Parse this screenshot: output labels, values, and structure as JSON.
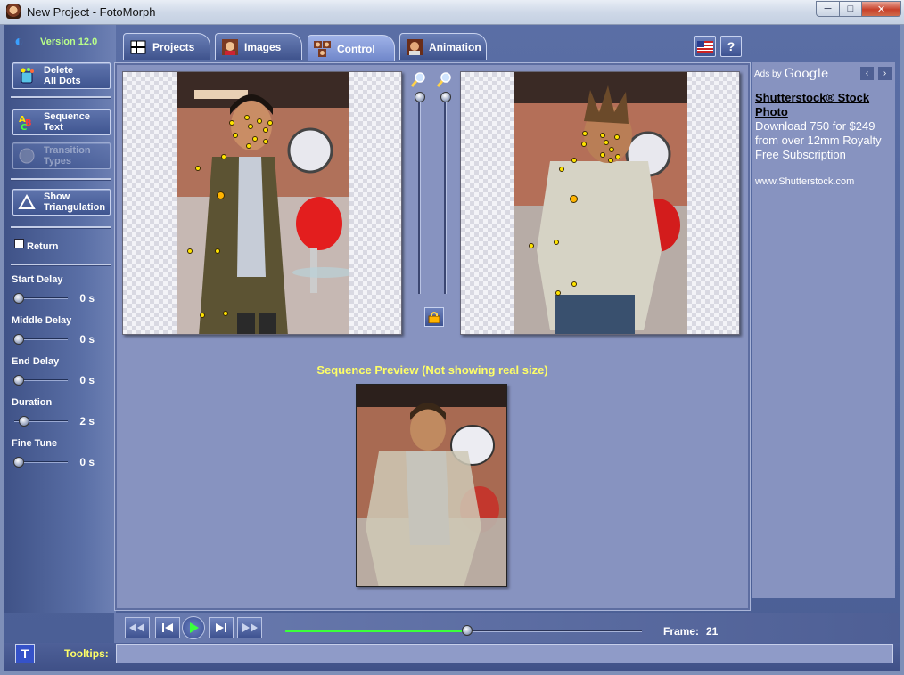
{
  "window": {
    "title": "New Project - FotoMorph",
    "min": "─",
    "max": "□",
    "close": "✕"
  },
  "sidebar": {
    "version": "Version 12.0",
    "buttons": [
      {
        "label": "Delete\nAll Dots",
        "icon": "paint-bucket-icon",
        "enabled": true
      },
      {
        "label": "Sequence\nText",
        "icon": "abc-text-icon",
        "enabled": true
      },
      {
        "label": "Transition\nTypes",
        "icon": "transition-icon",
        "enabled": false
      },
      {
        "label": "Show\nTriangulation",
        "icon": "triangle-icon",
        "enabled": true
      }
    ],
    "return_label": "Return",
    "return_checked": false,
    "sliders": [
      {
        "label": "Start Delay",
        "value": "0 s"
      },
      {
        "label": "Middle Delay",
        "value": "0 s"
      },
      {
        "label": "End Delay",
        "value": "0 s"
      },
      {
        "label": "Duration",
        "value": "2 s"
      },
      {
        "label": "Fine Tune",
        "value": "0 s"
      }
    ]
  },
  "tabs": [
    {
      "label": "Projects",
      "icon": "projects-grid-icon",
      "active": false
    },
    {
      "label": "Images",
      "icon": "images-portrait-icon",
      "active": false
    },
    {
      "label": "Control",
      "icon": "control-faces-icon",
      "active": true
    },
    {
      "label": "Animation",
      "icon": "animation-portrait-icon",
      "active": false
    }
  ],
  "top_icons": {
    "language": "us-flag-icon",
    "help": "?"
  },
  "workspace": {
    "preview_title": "Sequence Preview (Not showing real size)"
  },
  "ads": {
    "label": "Ads by",
    "brand": "Google",
    "title": "Shutterstock® Stock Photo",
    "body": "Download 750 for $249 from over 12mm Royalty Free Subscription",
    "url": "www.Shutterstock.com",
    "prev": "‹",
    "next": "›"
  },
  "player": {
    "frame_label": "Frame:",
    "frame_value": "21",
    "progress_fraction": 0.51
  },
  "tooltips": {
    "label": "Tooltips:",
    "text": "",
    "icon": "T"
  }
}
